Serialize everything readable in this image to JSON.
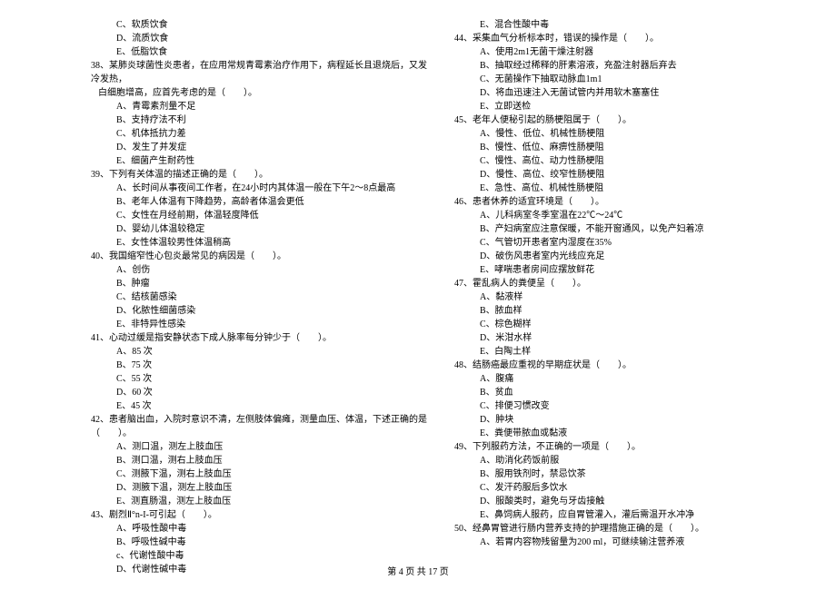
{
  "left": {
    "q37_opts": [
      "C、软质饮食",
      "D、流质饮食",
      "E、低脂饮食"
    ],
    "q38": "38、某肺炎球菌性炎患者，在应用常规青霉素治疗作用下，病程延长且退烧后，又发冷发热，",
    "q38_cont": "白细胞增高，应首先考虑的是（　　）。",
    "q38_opts": [
      "A、青霉素剂量不足",
      "B、支持疗法不利",
      "C、机体抵抗力差",
      "D、发生了并发症",
      "E、细菌产生耐药性"
    ],
    "q39": "39、下列有关体温的描述正确的是（　　）。",
    "q39_opts": [
      "A、长时间从事夜间工作者，在24小时内其体温一般在下午2～8点最高",
      "B、老年人体温有下降趋势，高龄者体温会更低",
      "C、女性在月经前期，体温轻度降低",
      "D、婴幼儿体温较稳定",
      "E、女性体温较男性体温稍高"
    ],
    "q40": "40、我国缩窄性心包炎最常见的病因是（　　）。",
    "q40_opts": [
      "A、创伤",
      "B、肿瘤",
      "C、结核菌感染",
      "D、化脓性细菌感染",
      "E、非特异性感染"
    ],
    "q41": "41、心动过缓是指安静状态下成人脉率每分钟少于（　　）。",
    "q41_opts": [
      "A、85 次",
      "B、75 次",
      "C、55 次",
      "D、60 次",
      "E、45 次"
    ],
    "q42": "42、患者脑出血，入院时意识不清，左侧肢体偏瘫，测量血压、体温，下述正确的是（　　）。",
    "q42_opts": [
      "A、测口温，测左上肢血压",
      "B、测口温，测右上肢血压",
      "C、测腋下温，测右上肢血压",
      "D、测腋下温，测左上肢血压",
      "E、测直肠温，测左上肢血压"
    ],
    "q43": "43、剧烈Ⅱ°n-I-可引起（　　）。",
    "q43_opts": [
      "A、呼吸性酸中毒",
      "B、呼吸性碱中毒",
      "c、代谢性酸中毒",
      "D、代谢性碱中毒"
    ]
  },
  "right": {
    "q43_opts": [
      "E、混合性酸中毒"
    ],
    "q44": "44、采集血气分析标本时，错误的操作是（　　）。",
    "q44_opts": [
      "A、使用2m1无菌干燥注射器",
      "B、抽取经过稀释的肝素溶液，充盈注射器后弃去",
      "C、无菌操作下抽取动脉血1m1",
      "D、将血迅速注入无菌试管内并用软木塞塞住",
      "E、立即送检"
    ],
    "q45": "45、老年人便秘引起的肠梗阻属于（　　）。",
    "q45_opts": [
      "A、慢性、低位、机械性肠梗阻",
      "B、慢性、低位、麻痹性肠梗阻",
      "C、慢性、高位、动力性肠梗阻",
      "D、慢性、高位、绞窄性肠梗阻",
      "E、急性、高位、机械性肠梗阻"
    ],
    "q46": "46、患者休养的适宜环境是（　　）。",
    "q46_opts": [
      "A、儿科病室冬季室温在22℃～24℃",
      "B、产妇病室应注意保暖，不能开窗通风，以免产妇着凉",
      "C、气管切开患者室内湿度在35%",
      "D、破伤风患者室内光线应充足",
      "E、哮喘患者房间应摆放鲜花"
    ],
    "q47": "47、霍乱病人的粪便呈（　　）。",
    "q47_opts": [
      "A、黏液样",
      "B、脓血样",
      "C、棕色糊样",
      "D、米泔水样",
      "E、白陶土样"
    ],
    "q48": "48、结肠癌最应重视的早期症状是（　　）。",
    "q48_opts": [
      "A、腹痛",
      "B、贫血",
      "C、排便习惯改变",
      "D、肿块",
      "E、粪便带脓血或黏液"
    ],
    "q49": "49、下列服药方法，不正确的一项是（　　）。",
    "q49_opts": [
      "A、助消化药饭前服",
      "B、服用铁剂时，禁忌饮茶",
      "C、发汗药服后多饮水",
      "D、服酸类时，避免与牙齿接触",
      "E、鼻饲病人服药，应自胃管灌入，灌后需温开水冲净"
    ],
    "q50": "50、经鼻胃管进行肠内营养支持的护理措施正确的是（　　）。",
    "q50_opts": [
      "A、若胃内容物残留量为200 ml，可继续输注营养液"
    ]
  },
  "footer": "第 4 页 共 17 页"
}
